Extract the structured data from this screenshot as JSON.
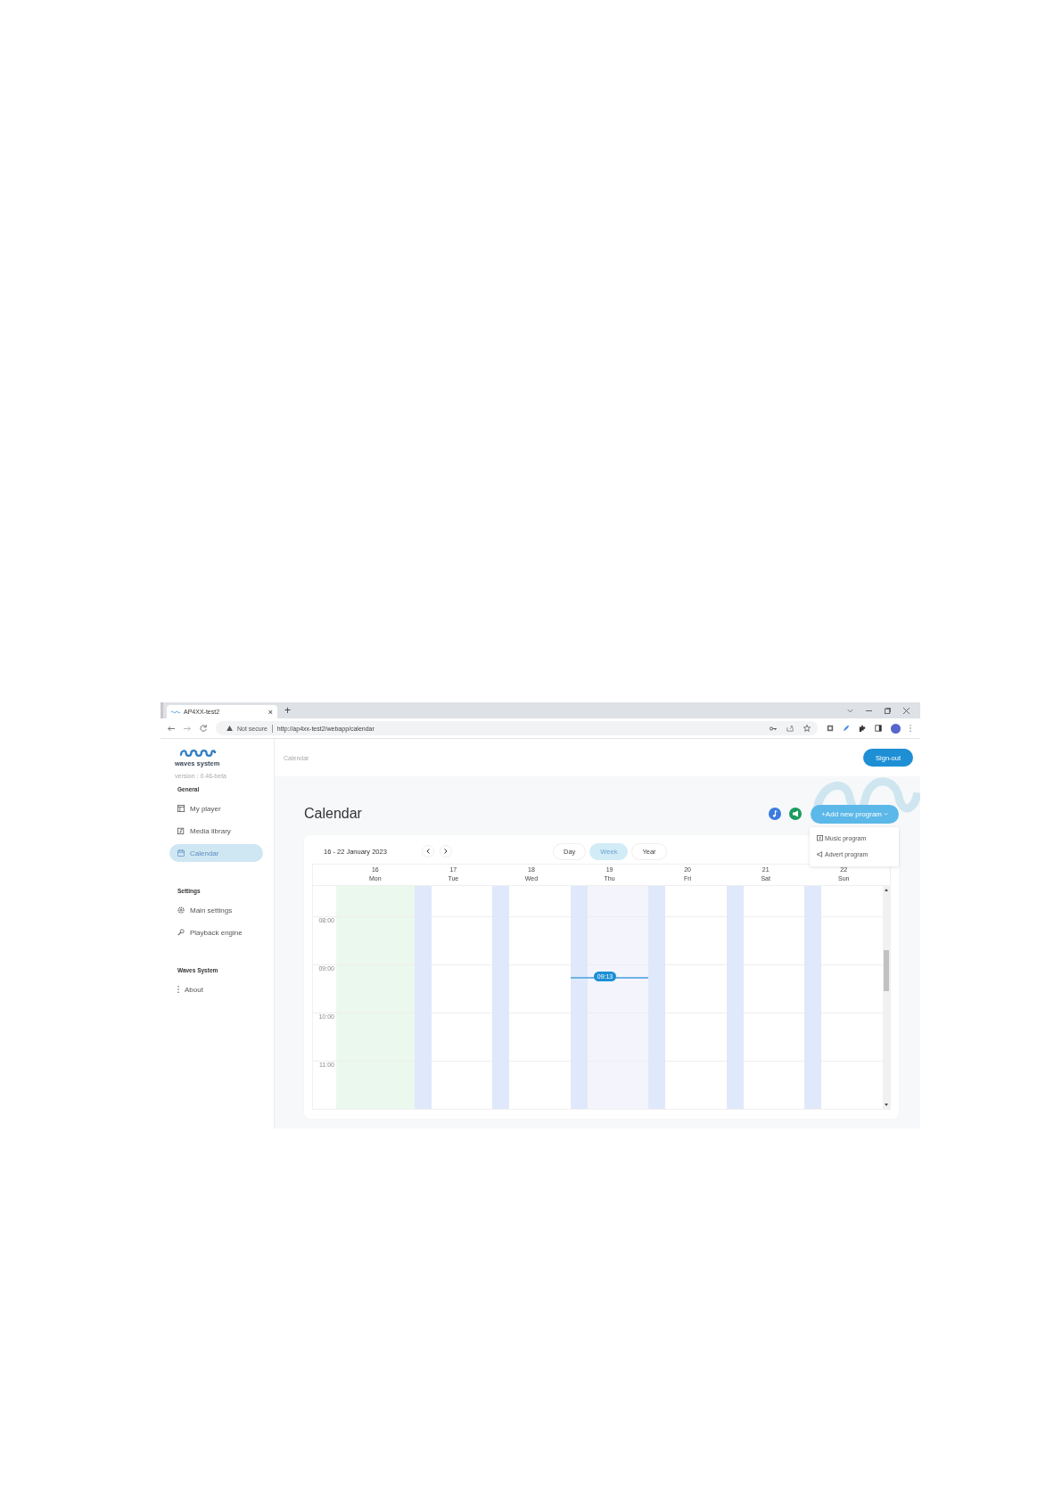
{
  "browser": {
    "tab_title": "AP4XX-test2",
    "tab_close": "×",
    "new_tab": "+",
    "security": "Not secure",
    "url": "http://ap4xx-test2/webapp/calendar"
  },
  "sidebar": {
    "logo_text": "waves system",
    "version": "version : 0.46-beta",
    "sections": [
      {
        "title": "General",
        "items": [
          {
            "label": "My player",
            "kind": "player",
            "selected": false
          },
          {
            "label": "Media library",
            "kind": "library",
            "selected": false
          },
          {
            "label": "Calendar",
            "kind": "calendar",
            "selected": true
          }
        ]
      },
      {
        "title": "Settings",
        "items": [
          {
            "label": "Main settings",
            "kind": "settings",
            "selected": false
          },
          {
            "label": "Playback engine",
            "kind": "engine",
            "selected": false
          }
        ]
      },
      {
        "title": "Waves System",
        "items": [
          {
            "label": "About",
            "kind": "about",
            "selected": false
          }
        ]
      }
    ]
  },
  "header": {
    "breadcrumb": "Calendar",
    "sign_out": "Sign-out"
  },
  "page": {
    "title": "Calendar",
    "add_button": "+Add new program",
    "menu": [
      {
        "label": "Music program",
        "kind": "music"
      },
      {
        "label": "Advert program",
        "kind": "advert"
      }
    ]
  },
  "calendar": {
    "range": "16 - 22 January 2023",
    "views": [
      {
        "label": "Day",
        "selected": false
      },
      {
        "label": "Week",
        "selected": true
      },
      {
        "label": "Year",
        "selected": false
      }
    ],
    "days": [
      {
        "date": "16",
        "weekday": "Mon",
        "highlighted": true,
        "blocked": false,
        "today": false
      },
      {
        "date": "17",
        "weekday": "Tue",
        "highlighted": false,
        "blocked": true,
        "today": false
      },
      {
        "date": "18",
        "weekday": "Wed",
        "highlighted": false,
        "blocked": true,
        "today": false
      },
      {
        "date": "19",
        "weekday": "Thu",
        "highlighted": false,
        "blocked": true,
        "today": true
      },
      {
        "date": "20",
        "weekday": "Fri",
        "highlighted": false,
        "blocked": true,
        "today": false
      },
      {
        "date": "21",
        "weekday": "Sat",
        "highlighted": false,
        "blocked": true,
        "today": false
      },
      {
        "date": "22",
        "weekday": "Sun",
        "highlighted": false,
        "blocked": true,
        "today": false
      }
    ],
    "hours": [
      "08:00",
      "09:00",
      "10:00",
      "11:00"
    ],
    "now": "09:13"
  }
}
